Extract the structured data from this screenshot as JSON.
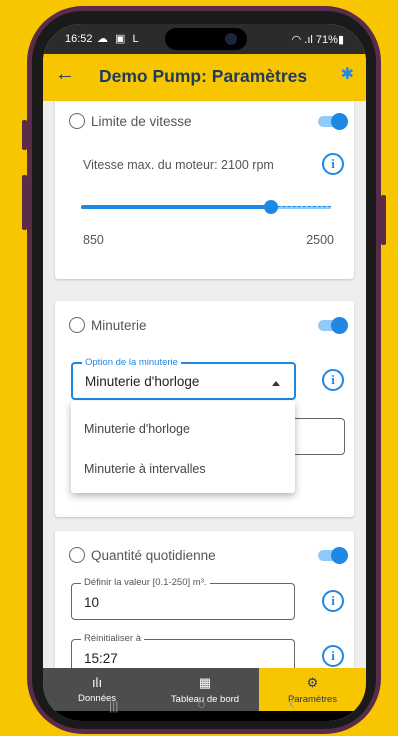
{
  "status": {
    "time": "16:52",
    "icons_left": "☁ ▣ L",
    "signal": "◠ .ıl",
    "battery": "71%▮"
  },
  "appbar": {
    "back_glyph": "←",
    "title": "Demo Pump: Paramètres",
    "bt_glyph": "✱"
  },
  "speed": {
    "title": "Limite de vitesse",
    "enabled": true,
    "label": "Vitesse max. du moteur: 2100 rpm",
    "min": "850",
    "max": "2500",
    "value_fraction": 0.76
  },
  "timer": {
    "title": "Minuterie",
    "enabled": true,
    "field_label": "Option de la minuterie",
    "field_value": "Minuterie d'horloge",
    "options": [
      "Minuterie d'horloge",
      "Minuterie à intervalles"
    ]
  },
  "daily": {
    "title": "Quantité quotidienne",
    "enabled": true,
    "value_label": "Définir la valeur [0.1-250] m³.",
    "value": "10",
    "reset_label": "Réinitialiser à",
    "reset_value": "15:27"
  },
  "nav": {
    "items": [
      {
        "label": "Données",
        "icon": "ılı"
      },
      {
        "label": "Tableau de bord",
        "icon": "▦"
      },
      {
        "label": "Paramètres",
        "icon": "⚙"
      }
    ],
    "active": "Paramètres"
  },
  "system_nav": {
    "recent": "|||",
    "home": "○",
    "back": "‹"
  },
  "colors": {
    "accent": "#1e88e5",
    "brand": "#f7c600",
    "title": "#1f3b5c"
  }
}
